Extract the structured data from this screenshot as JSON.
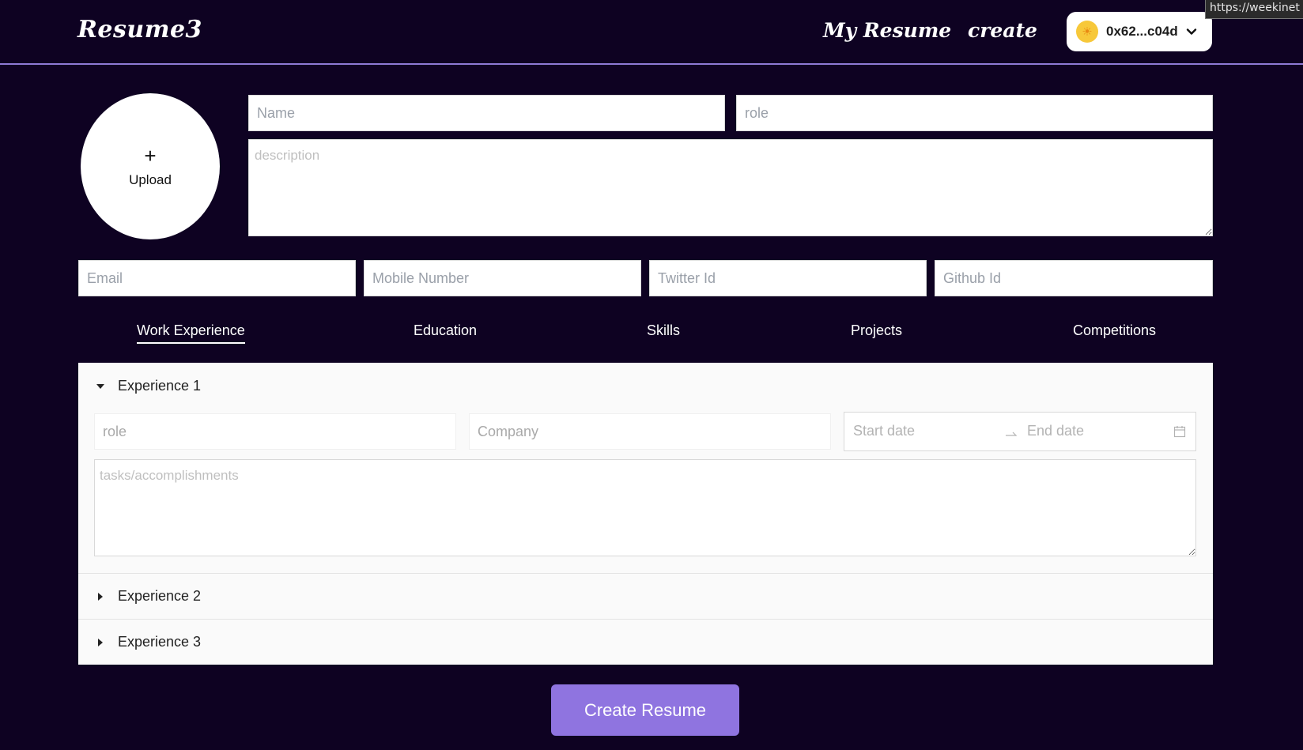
{
  "header": {
    "logo": "Resume3",
    "nav": {
      "my_resume": "My Resume",
      "create": "create"
    },
    "wallet": {
      "address": "0x62...c04d",
      "avatar_icon": "sun-emoji-icon"
    }
  },
  "tooltip": {
    "text": "https://weekinet"
  },
  "upload": {
    "plus": "+",
    "label": "Upload"
  },
  "profile": {
    "name_placeholder": "Name",
    "role_placeholder": "role",
    "description_placeholder": "description"
  },
  "contacts": {
    "email_placeholder": "Email",
    "mobile_placeholder": "Mobile Number",
    "twitter_placeholder": "Twitter Id",
    "github_placeholder": "Github Id"
  },
  "tabs": [
    {
      "label": "Work Experience",
      "active": true
    },
    {
      "label": "Education",
      "active": false
    },
    {
      "label": "Skills",
      "active": false
    },
    {
      "label": "Projects",
      "active": false
    },
    {
      "label": "Competitions",
      "active": false
    }
  ],
  "experiences": [
    {
      "title": "Experience 1",
      "expanded": true,
      "role_placeholder": "role",
      "company_placeholder": "Company",
      "start_placeholder": "Start date",
      "end_placeholder": "End date",
      "tasks_placeholder": "tasks/accomplishments"
    },
    {
      "title": "Experience 2",
      "expanded": false
    },
    {
      "title": "Experience 3",
      "expanded": false
    }
  ],
  "actions": {
    "create_label": "Create Resume"
  },
  "colors": {
    "background": "#0e0222",
    "accent": "#8f74e0",
    "header_border": "#8f7ad6"
  }
}
